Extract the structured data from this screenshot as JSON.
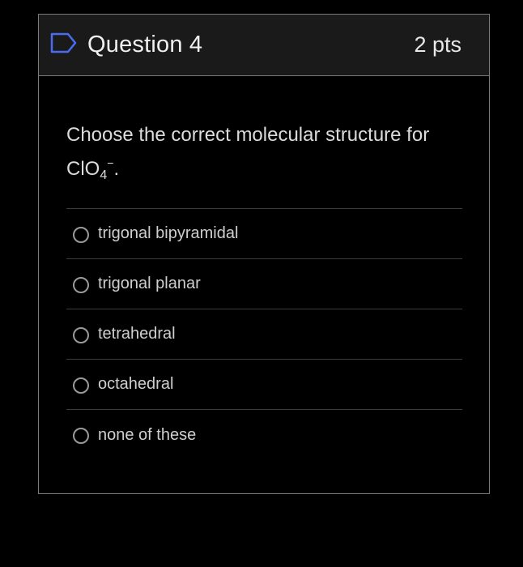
{
  "question": {
    "title": "Question 4",
    "points": "2 pts",
    "text_main": "Choose the correct molecular structure for ClO",
    "text_subscript": "4",
    "text_superscript": "−",
    "text_end": "."
  },
  "answers": [
    {
      "label": "trigonal bipyramidal"
    },
    {
      "label": "trigonal planar"
    },
    {
      "label": "tetrahedral"
    },
    {
      "label": "octahedral"
    },
    {
      "label": "none of these"
    }
  ],
  "colors": {
    "background": "#000000",
    "header_background": "#1a1a1a",
    "border": "#7a7a7a",
    "flag_icon": "#4a6cf0"
  },
  "icons": {
    "flag": "flag-icon",
    "radio": "radio-unchecked-icon"
  }
}
